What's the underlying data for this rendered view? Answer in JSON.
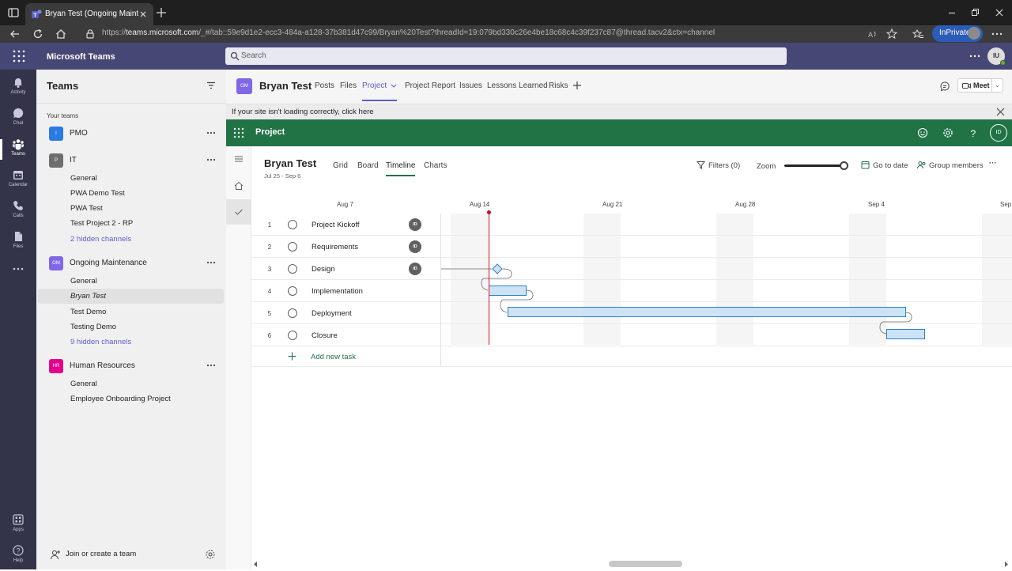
{
  "browser": {
    "tab_title": "Bryan Test (Ongoing Maintenanc",
    "url_prefix": "https://",
    "url_host": "teams.microsoft.com",
    "url_rest": "/_#/tab::59e9d1e2-ecc3-484a-a128-37b381d47c99/Bryan%20Test?threadId=19:079bd330c26e4be18c68c4c39f237c87@thread.tacv2&ctx=channel",
    "inprivate_label": "InPrivate"
  },
  "teams_header": {
    "app_title": "Microsoft Teams",
    "search_placeholder": "Search",
    "user_initials": "IU"
  },
  "rail": [
    {
      "label": "Activity",
      "icon": "bell-icon"
    },
    {
      "label": "Chat",
      "icon": "chat-icon"
    },
    {
      "label": "Teams",
      "icon": "teams-icon",
      "active": true
    },
    {
      "label": "Calendar",
      "icon": "calendar-icon"
    },
    {
      "label": "Calls",
      "icon": "phone-icon"
    },
    {
      "label": "Files",
      "icon": "file-icon"
    },
    {
      "label": "Apps",
      "icon": "apps-icon"
    },
    {
      "label": "Help",
      "icon": "help-icon"
    }
  ],
  "teams_panel": {
    "title": "Teams",
    "section_label": "Your teams",
    "teams": [
      {
        "initial": "I",
        "name": "PMO",
        "color": "#2a7ae2"
      },
      {
        "initial": "P",
        "name": "IT",
        "color": "#6e6e6e",
        "channels": [
          "General",
          "PWA Demo Test",
          "PWA Test",
          "Test Project 2 - RP"
        ],
        "hidden": "2 hidden channels"
      },
      {
        "initial": "OM",
        "name": "Ongoing Maintenance",
        "color": "#7f67e6",
        "channels": [
          "General",
          "Bryan Test",
          "Test Demo",
          "Testing Demo"
        ],
        "hidden": "9 hidden channels"
      },
      {
        "initial": "HR",
        "name": "Human Resources",
        "color": "#e3008c",
        "channels": [
          "General",
          "Employee Onboarding Project"
        ]
      }
    ],
    "join_label": "Join or create a team"
  },
  "channel_header": {
    "avatar": "OM",
    "title": "Bryan Test",
    "tabs": [
      "Posts",
      "Files",
      "Project",
      "Project Report",
      "Issues",
      "Lessons Learned",
      "Risks"
    ],
    "active_tab": "Project",
    "meet_label": "Meet"
  },
  "notice": {
    "text": "If your site isn't loading correctly, click here"
  },
  "project_header": {
    "title": "Project",
    "user_initials": "ID"
  },
  "project": {
    "name": "Bryan Test",
    "dates": "Jul 25 - Sep 6",
    "views": [
      "Grid",
      "Board",
      "Timeline",
      "Charts"
    ],
    "active_view": "Timeline",
    "filters_label": "Filters (0)",
    "zoom_label": "Zoom",
    "zoom_level": 0.92,
    "goto_label": "Go to date",
    "group_label": "Group members"
  },
  "timeline": {
    "dates": [
      "Aug 7",
      "Aug 14",
      "Aug 21",
      "Aug 28",
      "Sep 4",
      "Sep"
    ],
    "tasks": [
      {
        "num": "1",
        "name": "Project Kickoff",
        "assignee": "ID"
      },
      {
        "num": "2",
        "name": "Requirements",
        "assignee": "ID"
      },
      {
        "num": "3",
        "name": "Design",
        "assignee": "ID"
      },
      {
        "num": "4",
        "name": "Implementation",
        "assignee": ""
      },
      {
        "num": "5",
        "name": "Deployment",
        "assignee": ""
      },
      {
        "num": "6",
        "name": "Closure",
        "assignee": ""
      }
    ],
    "add_task_label": "Add new task"
  },
  "colors": {
    "teams_purple": "#464775",
    "project_green": "#217346",
    "today_red": "#c50f1f",
    "bar_fill": "#cce3f5",
    "bar_border": "#2f7ec4"
  }
}
